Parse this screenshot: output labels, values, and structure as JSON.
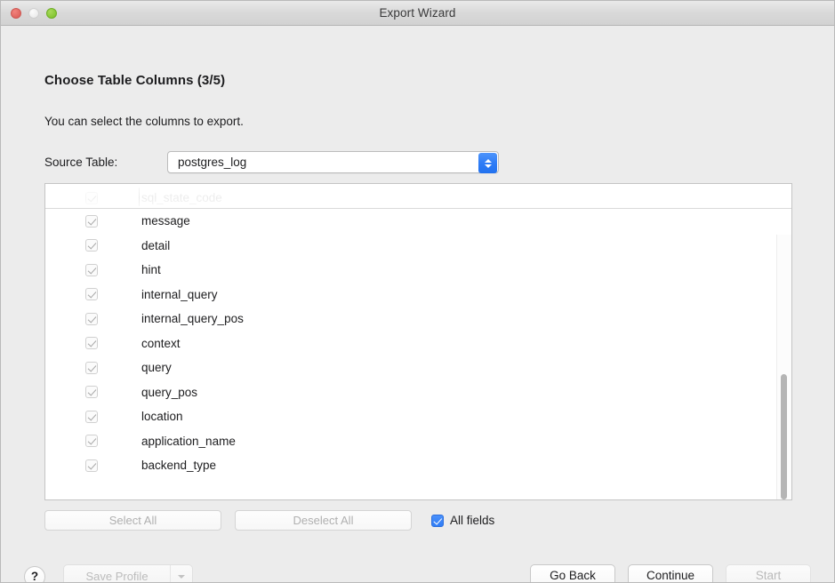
{
  "window": {
    "title": "Export Wizard",
    "traffic_lights": [
      {
        "name": "close",
        "color": "#e0655f"
      },
      {
        "name": "minimize",
        "color": "#ededed"
      },
      {
        "name": "maximize",
        "color": "#86c735"
      }
    ]
  },
  "page": {
    "heading": "Choose Table Columns (3/5)",
    "subheading": "You can select the columns to export."
  },
  "source": {
    "label": "Source Table:",
    "value": "postgres_log"
  },
  "columns_list": {
    "partial_top_row": {
      "label": "sql_state_code",
      "checked": true
    },
    "rows": [
      {
        "label": "message",
        "checked": true
      },
      {
        "label": "detail",
        "checked": true
      },
      {
        "label": "hint",
        "checked": true
      },
      {
        "label": "internal_query",
        "checked": true
      },
      {
        "label": "internal_query_pos",
        "checked": true
      },
      {
        "label": "context",
        "checked": true
      },
      {
        "label": "query",
        "checked": true
      },
      {
        "label": "query_pos",
        "checked": true
      },
      {
        "label": "location",
        "checked": true
      },
      {
        "label": "application_name",
        "checked": true
      },
      {
        "label": "backend_type",
        "checked": true
      }
    ]
  },
  "selection_controls": {
    "select_all_label": "Select All",
    "deselect_all_label": "Deselect All",
    "all_fields_label": "All fields",
    "all_fields_checked": true,
    "accent_color": "#2f7df6"
  },
  "footer": {
    "help_label": "?",
    "save_profile_label": "Save Profile",
    "go_back_label": "Go Back",
    "continue_label": "Continue",
    "start_label": "Start"
  }
}
